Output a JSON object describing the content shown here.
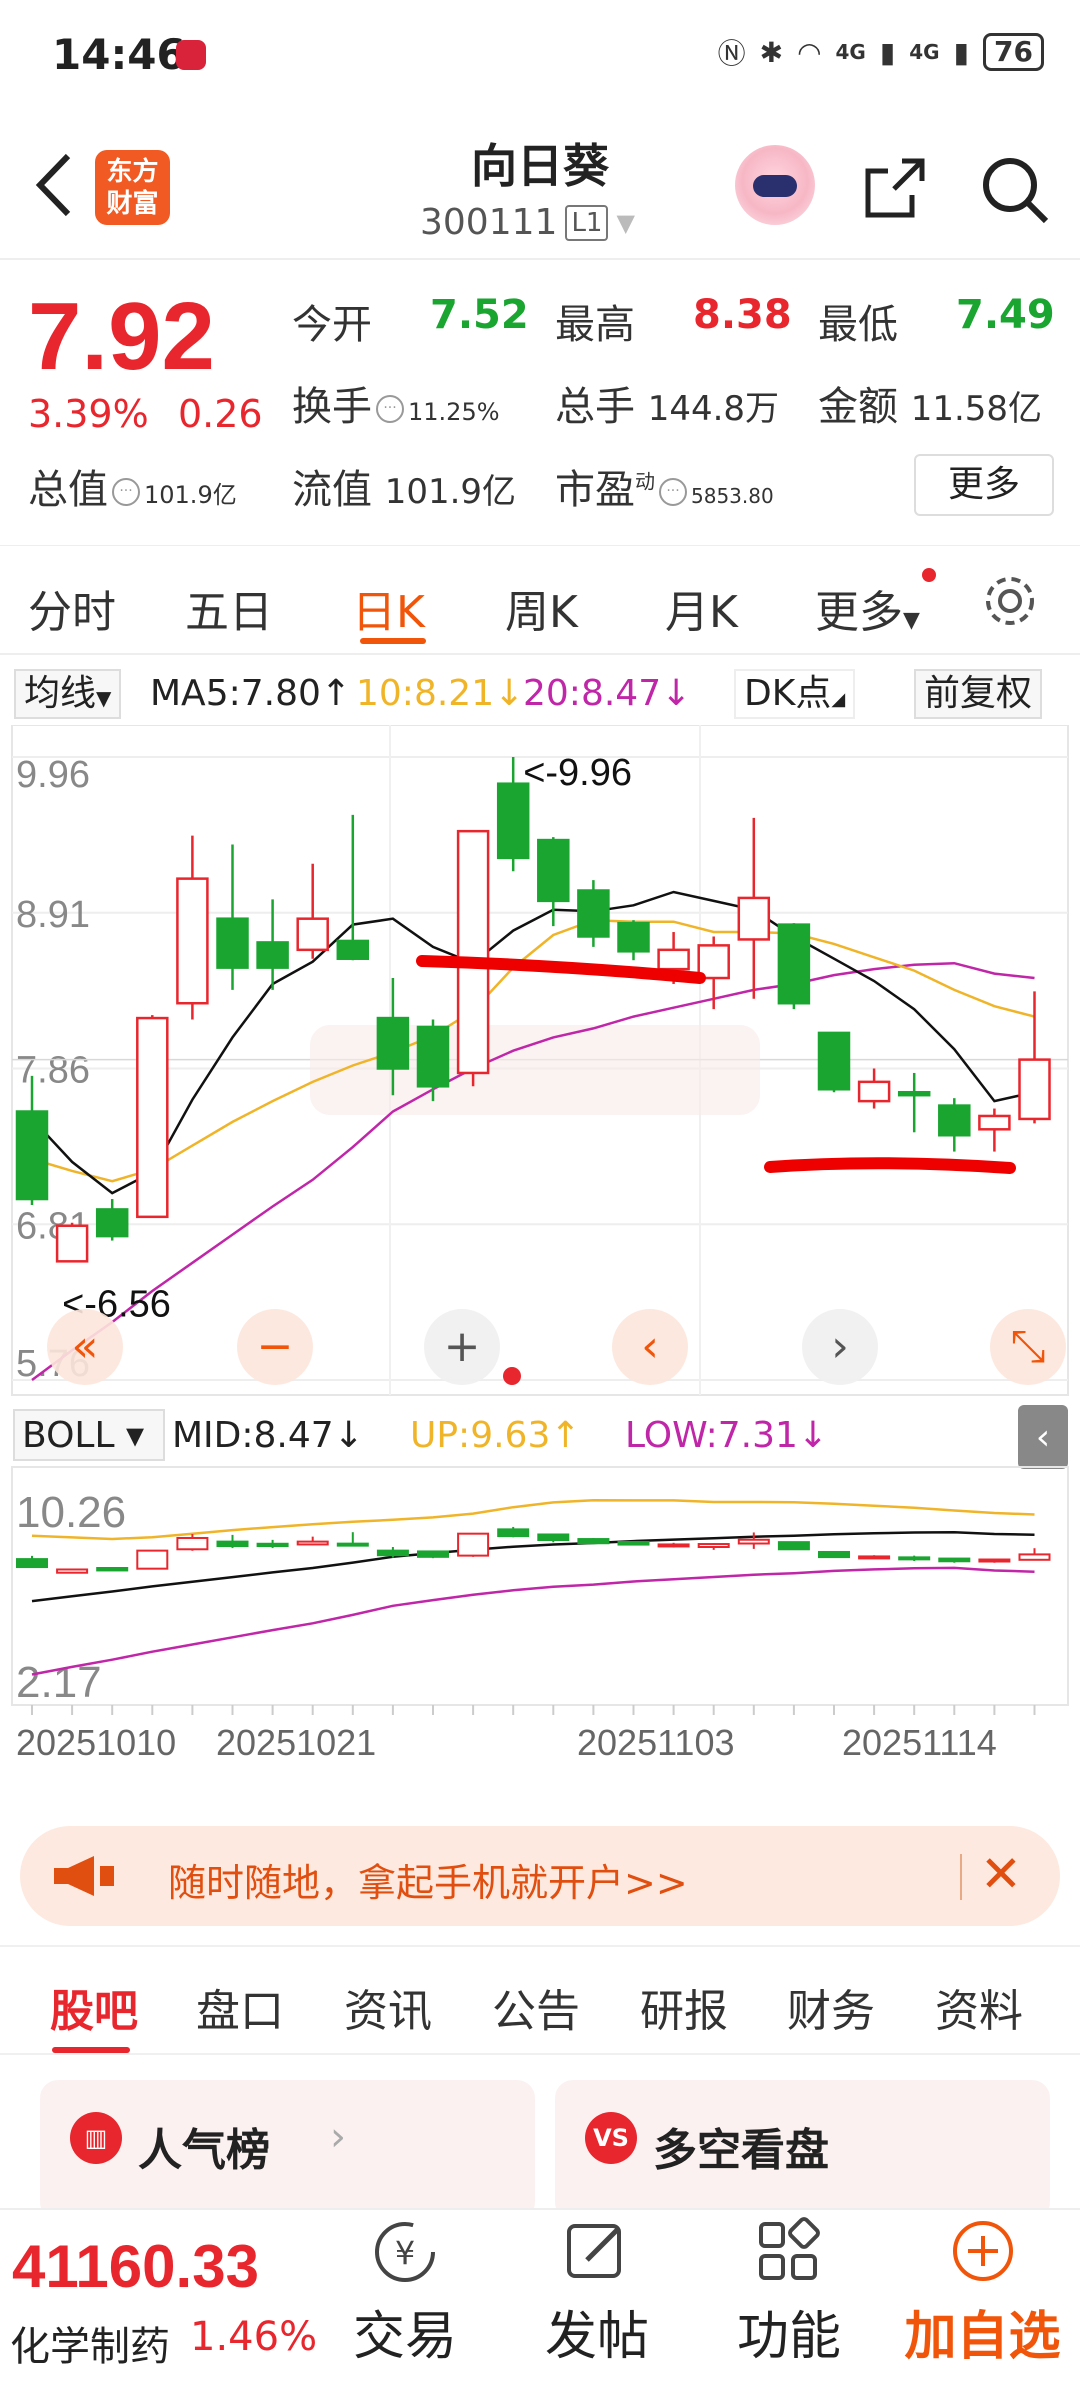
{
  "status_bar": {
    "time": "14:46",
    "network_left": "4G",
    "network_right": "4G",
    "battery": "76"
  },
  "header": {
    "logo_text": "东方财富",
    "title": "向日葵",
    "code": "300111",
    "level": "L1"
  },
  "quote": {
    "price": "7.92",
    "change_pct": "3.39%",
    "change": "0.26",
    "open_label": "今开",
    "open": "7.52",
    "high_label": "最高",
    "high": "8.38",
    "low_label": "最低",
    "low": "7.49",
    "turnover_label": "换手",
    "turnover": "11.25%",
    "volume_label": "总手",
    "volume": "144.8万",
    "amount_label": "金额",
    "amount": "11.58亿",
    "mktcap_label": "总值",
    "mktcap": "101.9亿",
    "float_label": "流值",
    "float": "101.9亿",
    "pe_label": "市盈",
    "pe_sup": "动",
    "pe": "5853.80",
    "more_label": "更多"
  },
  "tabs": [
    "分时",
    "五日",
    "日K",
    "周K",
    "月K",
    "更多"
  ],
  "ma_bar": {
    "selector": "均线",
    "ma5": "MA5:7.80",
    "ma10": "10:8.21",
    "ma20": "20:8.47",
    "dk": "DK点",
    "adjust": "前复权"
  },
  "boll_bar": {
    "selector": "BOLL",
    "mid": "MID:8.47",
    "up": "UP:9.63",
    "low": "LOW:7.31"
  },
  "colors": {
    "up": "#e8262d",
    "down": "#1aa531",
    "ma5": "#111111",
    "ma10": "#f0b429",
    "ma20": "#c026a8",
    "accent": "#f0550a"
  },
  "chart_data": {
    "type": "candlestick",
    "y_ticks": [
      "9.96",
      "8.91",
      "7.86",
      "6.81",
      "5.76"
    ],
    "boll_y_ticks": [
      "10.26",
      "2.17"
    ],
    "x_ticks": [
      "20251010",
      "20251021",
      "20251103",
      "20251114"
    ],
    "annotations": [
      "<-9.96",
      "<-6.56"
    ],
    "ylim": [
      5.76,
      9.96
    ],
    "candles": [
      {
        "o": 7.57,
        "c": 6.98,
        "h": 7.81,
        "l": 6.94
      },
      {
        "o": 6.56,
        "c": 6.8,
        "h": 6.82,
        "l": 6.56
      },
      {
        "o": 6.91,
        "c": 6.73,
        "h": 6.98,
        "l": 6.7
      },
      {
        "o": 6.86,
        "c": 8.2,
        "h": 8.22,
        "l": 6.86
      },
      {
        "o": 8.3,
        "c": 9.14,
        "h": 9.43,
        "l": 8.19
      },
      {
        "o": 8.87,
        "c": 8.54,
        "h": 9.37,
        "l": 8.39
      },
      {
        "o": 8.71,
        "c": 8.54,
        "h": 9.0,
        "l": 8.39
      },
      {
        "o": 8.66,
        "c": 8.87,
        "h": 9.24,
        "l": 8.6
      },
      {
        "o": 8.72,
        "c": 8.6,
        "h": 9.57,
        "l": 8.59
      },
      {
        "o": 8.2,
        "c": 7.86,
        "h": 8.47,
        "l": 7.68
      },
      {
        "o": 8.14,
        "c": 7.74,
        "h": 8.19,
        "l": 7.64
      },
      {
        "o": 7.83,
        "c": 9.46,
        "h": 9.46,
        "l": 7.74
      },
      {
        "o": 9.78,
        "c": 9.28,
        "h": 9.96,
        "l": 9.19
      },
      {
        "o": 9.4,
        "c": 8.99,
        "h": 9.42,
        "l": 8.82
      },
      {
        "o": 9.06,
        "c": 8.75,
        "h": 9.13,
        "l": 8.68
      },
      {
        "o": 8.84,
        "c": 8.65,
        "h": 8.86,
        "l": 8.59
      },
      {
        "o": 8.53,
        "c": 8.66,
        "h": 8.78,
        "l": 8.43
      },
      {
        "o": 8.47,
        "c": 8.69,
        "h": 8.75,
        "l": 8.26
      },
      {
        "o": 8.73,
        "c": 9.01,
        "h": 9.55,
        "l": 8.33
      },
      {
        "o": 8.83,
        "c": 8.3,
        "h": 8.84,
        "l": 8.26
      },
      {
        "o": 8.1,
        "c": 7.72,
        "h": 8.1,
        "l": 7.7
      },
      {
        "o": 7.64,
        "c": 7.77,
        "h": 7.86,
        "l": 7.59
      },
      {
        "o": 7.7,
        "c": 7.68,
        "h": 7.83,
        "l": 7.43
      },
      {
        "o": 7.61,
        "c": 7.41,
        "h": 7.66,
        "l": 7.3
      },
      {
        "o": 7.45,
        "c": 7.54,
        "h": 7.59,
        "l": 7.3
      },
      {
        "o": 7.52,
        "c": 7.92,
        "h": 8.38,
        "l": 7.49
      }
    ],
    "ma5": [
      7.52,
      7.23,
      7.02,
      7.16,
      7.65,
      8.07,
      8.43,
      8.58,
      8.83,
      8.87,
      8.68,
      8.57,
      8.79,
      8.93,
      8.92,
      8.96,
      9.05,
      8.99,
      8.93,
      8.75,
      8.6,
      8.45,
      8.26,
      7.99,
      7.64,
      7.7
    ],
    "ma10": [
      7.25,
      7.17,
      7.1,
      7.18,
      7.34,
      7.5,
      7.64,
      7.77,
      7.88,
      7.97,
      8.08,
      8.25,
      8.54,
      8.76,
      8.86,
      8.85,
      8.85,
      8.78,
      8.78,
      8.77,
      8.7,
      8.61,
      8.52,
      8.39,
      8.28,
      8.21
    ],
    "ma20": [
      5.76,
      5.96,
      6.15,
      6.36,
      6.55,
      6.74,
      6.93,
      7.11,
      7.33,
      7.57,
      7.72,
      7.86,
      7.98,
      8.07,
      8.13,
      8.21,
      8.27,
      8.33,
      8.39,
      8.43,
      8.49,
      8.53,
      8.56,
      8.57,
      8.5,
      8.47
    ],
    "boll": {
      "mid": 8.47,
      "up": 9.63,
      "low": 7.31
    }
  },
  "promo": {
    "text": "随时随地，拿起手机就开户>>"
  },
  "subtabs": [
    "股吧",
    "盘口",
    "资讯",
    "公告",
    "研报",
    "财务",
    "资料"
  ],
  "cards": [
    {
      "title": "人气榜",
      "icon": "hot-rank-icon"
    },
    {
      "title": "多空看盘",
      "icon": "vs-icon",
      "badge": "VS"
    }
  ],
  "bottom": {
    "index_value": "41160.33",
    "index_name": "化学制药",
    "index_pct": "1.46%",
    "trade": "交易",
    "post": "发帖",
    "func": "功能",
    "add": "加自选"
  }
}
